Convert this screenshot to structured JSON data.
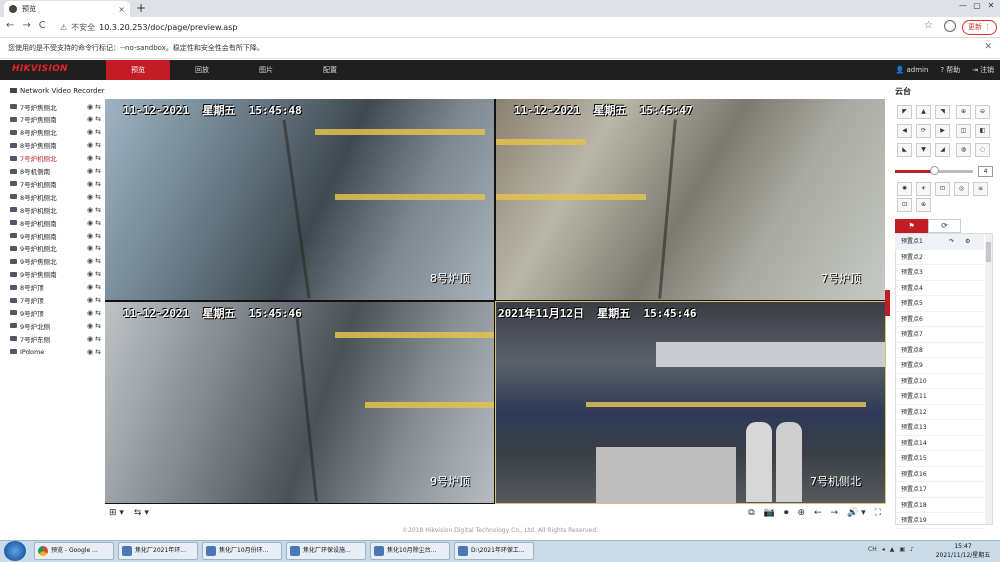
{
  "browser": {
    "tab_title": "预览",
    "tab_close": "×",
    "new_tab": "+",
    "window_controls": [
      "—",
      "▢",
      "✕"
    ],
    "nav": [
      "←",
      "→",
      "C"
    ],
    "insecure_icon": "⚠",
    "insecure_label": "不安全",
    "url": "10.3.20.253/doc/page/preview.asp",
    "star": "☆",
    "update_label": "更新 ⋮",
    "infobar_text": "您使用的是不受支持的命令行标记：--no-sandbox。稳定性和安全性会有所下降。",
    "infobar_close": "✕"
  },
  "app": {
    "logo": "HIKVISION",
    "nav": [
      "预览",
      "回放",
      "图片",
      "配置"
    ],
    "active_nav": 0,
    "user": "admin",
    "user_icon": "👤",
    "help": "帮助",
    "help_icon": "?",
    "logout": "注销",
    "logout_icon": "⇥",
    "copyright": "©2018 Hikvision Digital Technology Co., Ltd. All Rights Reserved."
  },
  "tree": {
    "root": "Network Video Recorder",
    "items": [
      "7号炉焦侧北",
      "7号炉焦侧南",
      "8号炉焦侧北",
      "8号炉焦侧南",
      "7号炉机侧北",
      "8号机侧南",
      "7号炉机侧南",
      "8号炉机侧北",
      "8号炉机侧北",
      "8号炉机侧南",
      "9号炉机侧南",
      "9号炉机侧北",
      "9号炉焦侧北",
      "9号炉焦侧南",
      "8号炉顶",
      "7号炉顶",
      "9号炉顶",
      "9号炉北侧",
      "7号炉东侧",
      "IPdome"
    ],
    "selected": 4,
    "row_icons": [
      "◉",
      "⇆"
    ]
  },
  "video": {
    "tiles": [
      {
        "timestamp": "11-12-2021  星期五  15:45:48",
        "caption": "8号炉顶"
      },
      {
        "timestamp": "11-12-2021  星期五  15:45:47",
        "caption": "7号炉顶"
      },
      {
        "timestamp": "11-12-2021  星期五  15:45:46",
        "caption": "9号炉顶"
      },
      {
        "timestamp": "2021年11月12日  星期五  15:45:46",
        "caption": "7号机侧北"
      }
    ],
    "toolbar_left": [
      "⊞ ▾",
      "⇆ ▾"
    ],
    "toolbar_right": [
      "⧉",
      "📷",
      "⏺",
      "⊕",
      "←",
      "→",
      "🔊 ▾",
      "⛶"
    ]
  },
  "ptz": {
    "title": "云台",
    "dir_buttons": [
      "◤",
      "▲",
      "◥",
      "◀",
      "⟳",
      "▶",
      "◣",
      "▼",
      "◢"
    ],
    "zoom_buttons": [
      "⊕",
      "⊖",
      "◫",
      "◧",
      "◍",
      "◌"
    ],
    "speed": "4",
    "speed_level": 0.5,
    "func_buttons": [
      "✺",
      "☀",
      "⊡",
      "◎",
      "≡",
      "⊡",
      "⊕"
    ],
    "preset_tab_icons": [
      "⚑",
      "⟳"
    ],
    "presets": [
      "预置点1",
      "预置点2",
      "预置点3",
      "预置点4",
      "预置点5",
      "预置点6",
      "预置点7",
      "预置点8",
      "预置点9",
      "预置点10",
      "预置点11",
      "预置点12",
      "预置点13",
      "预置点14",
      "预置点15",
      "预置点16",
      "预置点17",
      "预置点18",
      "预置点19"
    ],
    "preset_actions": [
      "↷",
      "⚙"
    ]
  },
  "taskbar": {
    "items": [
      {
        "label": "预览 - Google ...",
        "type": "chrome"
      },
      {
        "label": "焦化厂2021年环...",
        "type": "doc"
      },
      {
        "label": "焦化厂10月份环...",
        "type": "doc"
      },
      {
        "label": "焦化厂环保设施...",
        "type": "doc"
      },
      {
        "label": "焦化10月除尘台...",
        "type": "doc"
      },
      {
        "label": "D:\\2021年环保工...",
        "type": "doc"
      }
    ],
    "tray": [
      "CH",
      "◂",
      "▲",
      "▣",
      "♪"
    ],
    "time": "15:47",
    "date": "2021/11/12/星期五"
  },
  "colors": {
    "accent": "#c21d24",
    "header_bg": "#1f1f1f"
  }
}
